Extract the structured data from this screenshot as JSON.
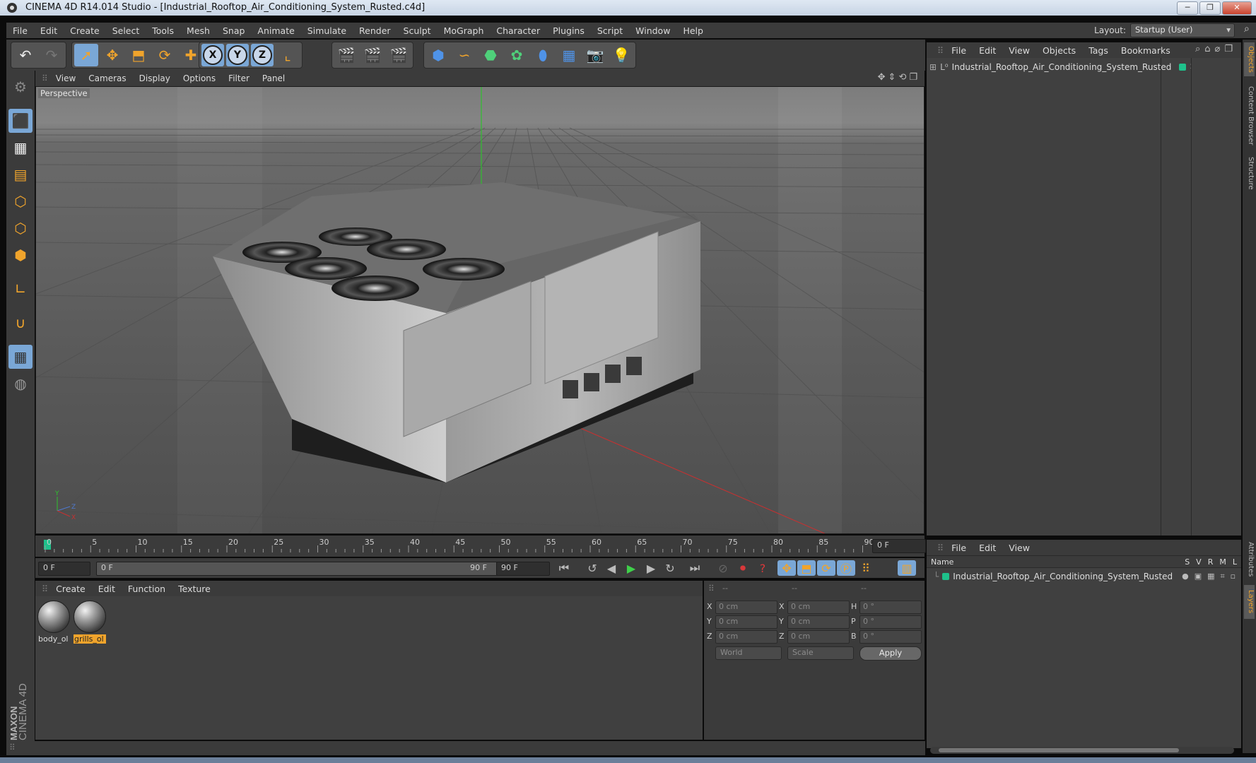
{
  "window": {
    "title": "CINEMA 4D R14.014 Studio - [Industrial_Rooftop_Air_Conditioning_System_Rusted.c4d]",
    "minimize": "─",
    "maximize": "❐",
    "close": "✕"
  },
  "menubar": {
    "items": [
      "File",
      "Edit",
      "Create",
      "Select",
      "Tools",
      "Mesh",
      "Snap",
      "Animate",
      "Simulate",
      "Render",
      "Sculpt",
      "MoGraph",
      "Character",
      "Plugins",
      "Script",
      "Window",
      "Help"
    ],
    "layout_label": "Layout:",
    "layout_value": "Startup (User)"
  },
  "toolbar": {
    "icons": [
      "undo-icon",
      "redo-icon",
      "live-selection-icon",
      "move-icon",
      "scale-icon",
      "rotate-icon",
      "add-icon",
      "x-axis-icon",
      "y-axis-icon",
      "z-axis-icon",
      "coordinate-system-icon",
      "render-view-icon",
      "render-picture-viewer-icon",
      "edit-render-settings-icon",
      "cube-icon",
      "spline-pen-icon",
      "subdivision-surface-icon",
      "array-icon",
      "deformer-icon",
      "floor-icon",
      "camera-icon",
      "light-icon"
    ],
    "axis_labels": [
      "X",
      "Y",
      "Z"
    ]
  },
  "viewport": {
    "menu": [
      "View",
      "Cameras",
      "Display",
      "Options",
      "Filter",
      "Panel"
    ],
    "label": "Perspective",
    "axis_y": "Y",
    "axis_z": "Z",
    "axis_x": "X"
  },
  "timeline": {
    "ticks": [
      "0",
      "5",
      "10",
      "15",
      "20",
      "25",
      "30",
      "35",
      "40",
      "45",
      "50",
      "55",
      "60",
      "65",
      "70",
      "75",
      "80",
      "85",
      "90"
    ],
    "current_frame": "0 F"
  },
  "playbar": {
    "start": "0 F",
    "range_start": "0 F",
    "range_end": "90 F",
    "end": "90 F"
  },
  "materials": {
    "menu": [
      "Create",
      "Edit",
      "Function",
      "Texture"
    ],
    "items": [
      {
        "label": "body_ol",
        "selected": false
      },
      {
        "label": "grills_ol",
        "selected": true
      }
    ]
  },
  "coordinates": {
    "headers": [
      "--",
      "--",
      "--"
    ],
    "rows": [
      {
        "l1": "X",
        "v1": "0 cm",
        "l2": "X",
        "v2": "0 cm",
        "l3": "H",
        "v3": "0 °"
      },
      {
        "l1": "Y",
        "v1": "0 cm",
        "l2": "Y",
        "v2": "0 cm",
        "l3": "P",
        "v3": "0 °"
      },
      {
        "l1": "Z",
        "v1": "0 cm",
        "l2": "Z",
        "v2": "0 cm",
        "l3": "B",
        "v3": "0 °"
      }
    ],
    "world": "World",
    "scale": "Scale",
    "apply": "Apply"
  },
  "objects_panel": {
    "menu": [
      "File",
      "Edit",
      "View",
      "Objects",
      "Tags",
      "Bookmarks"
    ],
    "object_name": "Industrial_Rooftop_Air_Conditioning_System_Rusted",
    "layer_dot_color": "#1ec18b"
  },
  "layers_panel": {
    "menu": [
      "File",
      "Edit",
      "View"
    ],
    "header_name": "Name",
    "flags": [
      "S",
      "V",
      "R",
      "M",
      "L"
    ],
    "layer_name": "Industrial_Rooftop_Air_Conditioning_System_Rusted"
  },
  "side_tabs": [
    "Objects",
    "Content Browser",
    "Structure",
    "Attributes",
    "Layers"
  ],
  "brand": {
    "maxon": "MAXON",
    "product": "CINEMA 4D"
  },
  "colors": {
    "accent": "#f0a42c",
    "active_blue": "#7aa7d6",
    "bg": "#3b3b3b"
  }
}
